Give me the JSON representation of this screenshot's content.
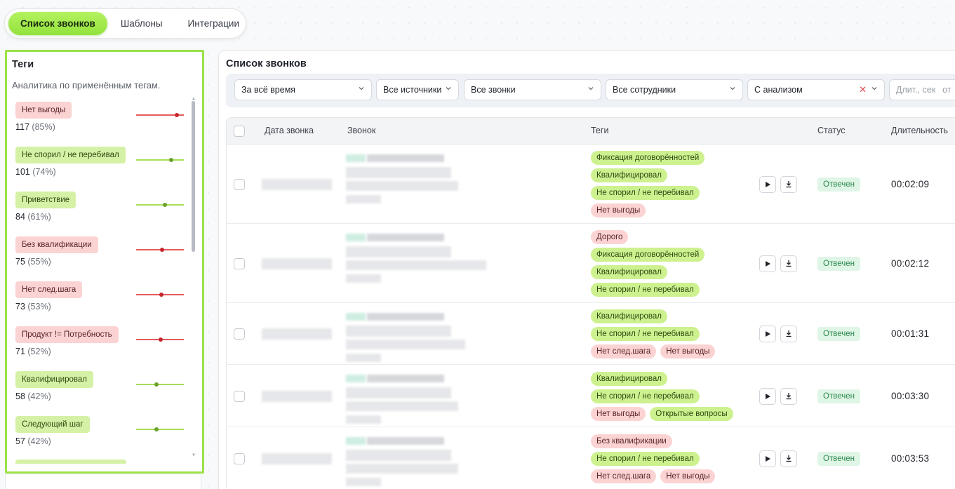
{
  "nav": {
    "tabs": [
      {
        "label": "Список звонков",
        "active": true
      },
      {
        "label": "Шаблоны",
        "active": false
      },
      {
        "label": "Интеграции",
        "active": false
      }
    ]
  },
  "tags_panel": {
    "title": "Теги",
    "subtitle": "Аналитика по применённым тегам.",
    "items": [
      {
        "label": "Нет выгоды",
        "count": "117",
        "pct": "(85%)",
        "color": "red",
        "level": 0.85
      },
      {
        "label": "Не спорил / не перебивал",
        "count": "101",
        "pct": "(74%)",
        "color": "green",
        "level": 0.74
      },
      {
        "label": "Приветствие",
        "count": "84",
        "pct": "(61%)",
        "color": "green",
        "level": 0.61
      },
      {
        "label": "Без квалификации",
        "count": "75",
        "pct": "(55%)",
        "color": "red",
        "level": 0.55
      },
      {
        "label": "Нет след.шага",
        "count": "73",
        "pct": "(53%)",
        "color": "red",
        "level": 0.53
      },
      {
        "label": "Продукт != Потребность",
        "count": "71",
        "pct": "(52%)",
        "color": "red",
        "level": 0.52
      },
      {
        "label": "Квалифицировал",
        "count": "58",
        "pct": "(42%)",
        "color": "green",
        "level": 0.42
      },
      {
        "label": "Следующий шаг",
        "count": "57",
        "pct": "(42%)",
        "color": "green",
        "level": 0.42
      }
    ]
  },
  "calls": {
    "title": "Список звонков",
    "filters": {
      "period": "За всё время",
      "sources": "Все источники",
      "calls": "Все звонки",
      "employees": "Все сотрудники",
      "analysis": "С анализом",
      "duration_placeholder": "Длит., сек",
      "duration_from": "от"
    },
    "columns": {
      "date": "Дата звонка",
      "call": "Звонок",
      "tags": "Теги",
      "status": "Статус",
      "duration": "Длительность"
    },
    "rows": [
      {
        "tags": [
          [
            "Фиксация договорённостей|green"
          ],
          [
            "Квалифицировал|green"
          ],
          [
            "Не спорил / не перебивал|green"
          ],
          [
            "Нет выгоды|red"
          ]
        ],
        "status": "Отвечен",
        "duration": "00:02:09"
      },
      {
        "tags": [
          [
            "Дорого|red"
          ],
          [
            "Фиксация договорённостей|green"
          ],
          [
            "Квалифицировал|green"
          ],
          [
            "Не спорил / не перебивал|green"
          ]
        ],
        "status": "Отвечен",
        "duration": "00:02:12"
      },
      {
        "tags": [
          [
            "Квалифицировал|green"
          ],
          [
            "Не спорил / не перебивал|green"
          ],
          [
            "Нет след.шага|red",
            "Нет выгоды|red"
          ]
        ],
        "status": "Отвечен",
        "duration": "00:01:31"
      },
      {
        "tags": [
          [
            "Квалифицировал|green"
          ],
          [
            "Не спорил / не перебивал|green"
          ],
          [
            "Нет выгоды|red",
            "Открытые вопросы|green"
          ]
        ],
        "status": "Отвечен",
        "duration": "00:03:30"
      },
      {
        "tags": [
          [
            "Без квалификации|red"
          ],
          [
            "Не спорил / не перебивал|green"
          ],
          [
            "Нет след.шага|red",
            "Нет выгоды|red"
          ]
        ],
        "status": "Отвечен",
        "duration": "00:03:53"
      }
    ]
  },
  "icons": {
    "play": "play-icon",
    "download": "download-icon",
    "chevron": "chevron-down-icon",
    "clear": "clear-icon"
  },
  "colors": {
    "accent": "#9be148",
    "tag_red_bg": "#fbd3d3",
    "tag_green_bg": "#cdf18f",
    "status_bg": "#dff5e6",
    "status_text": "#2e8a4d"
  }
}
